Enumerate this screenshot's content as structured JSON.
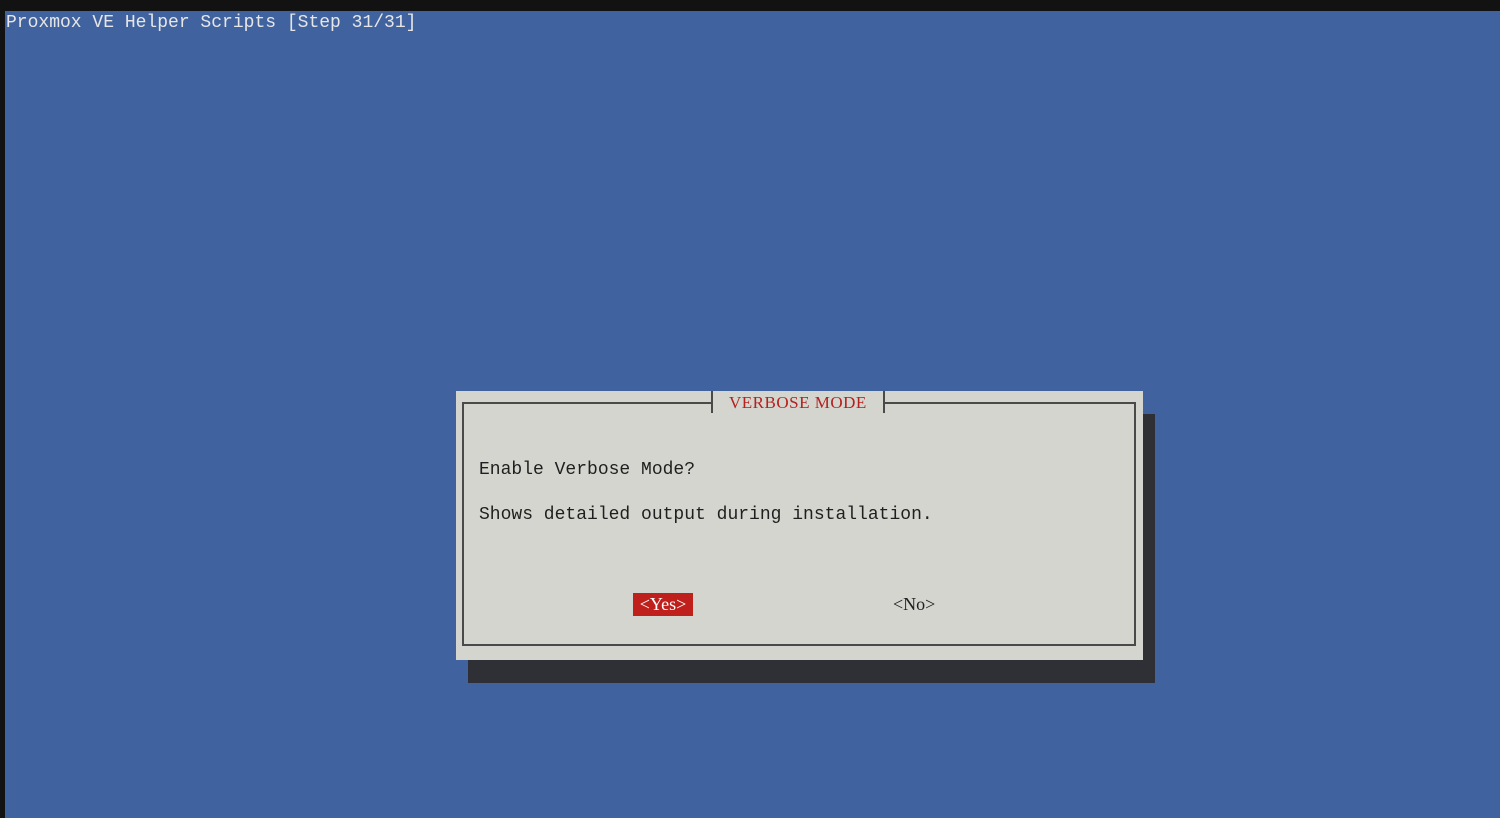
{
  "window": {
    "backtitle": "Proxmox VE Helper Scripts [Step 31/31]"
  },
  "dialog": {
    "title": "VERBOSE MODE",
    "message_line_1": "Enable Verbose Mode?",
    "message_line_2": "Shows detailed output during installation.",
    "yes_label": "<Yes>",
    "no_label": "<No>",
    "selected_button": "yes"
  },
  "colors": {
    "background": "#4063a0",
    "dialog": "#d4d5cf",
    "accent": "#c0201c",
    "title": "#b4211e",
    "shadow": "#2e3035"
  }
}
